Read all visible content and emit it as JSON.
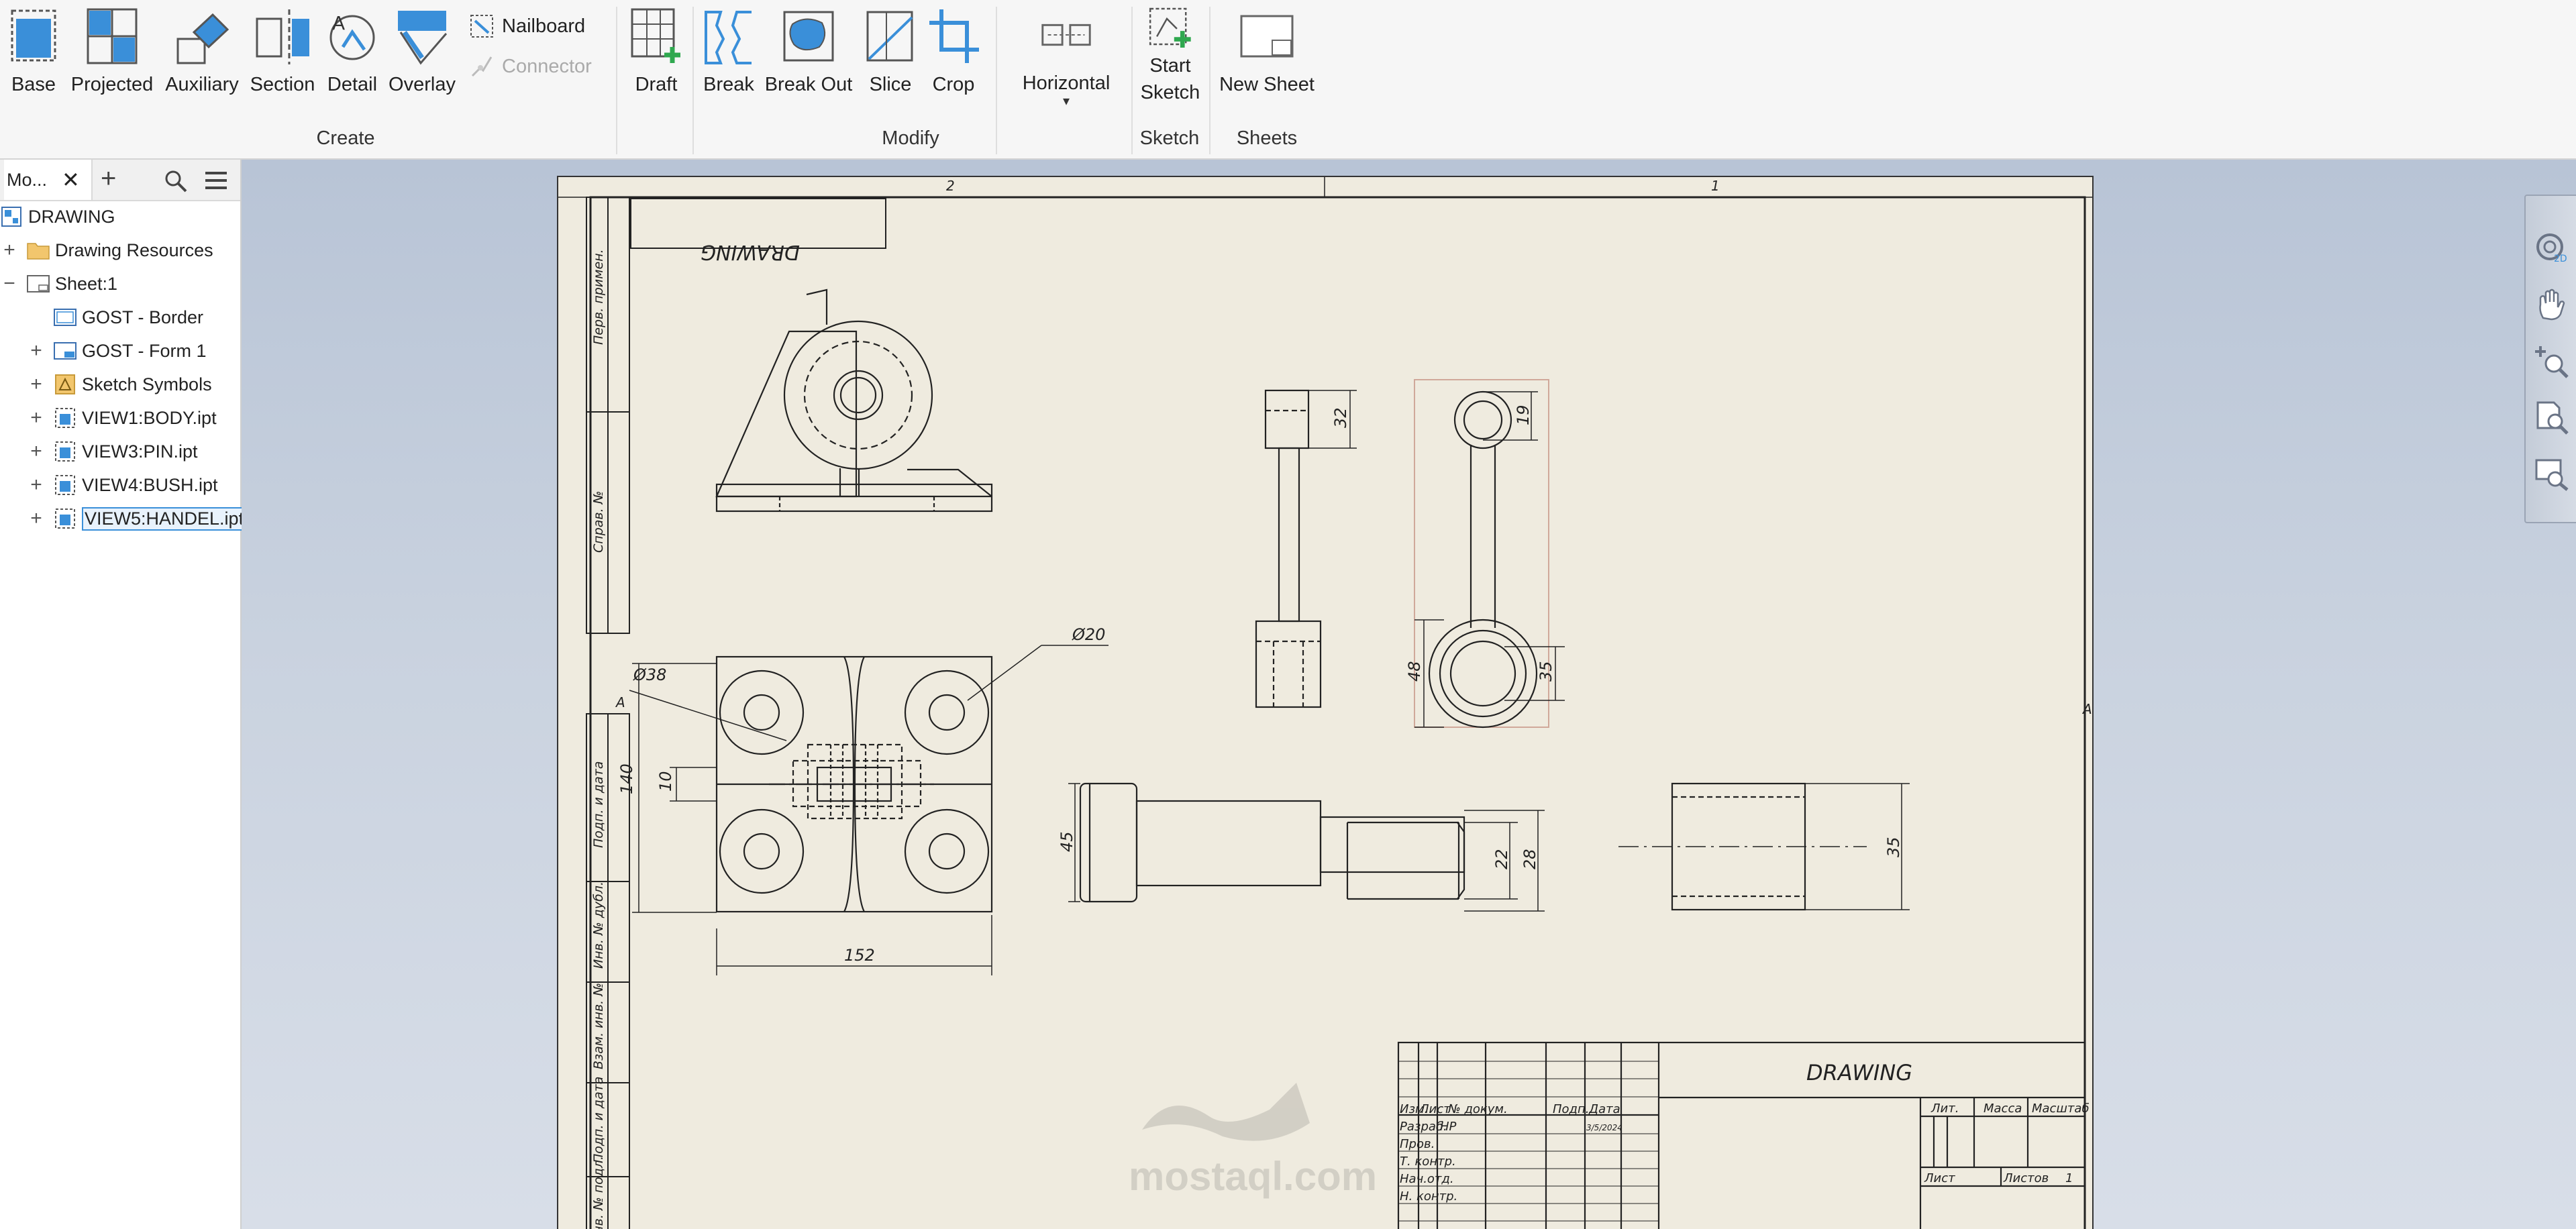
{
  "ribbon": {
    "create": {
      "group_label": "Create",
      "base": "Base",
      "projected": "Projected",
      "auxiliary": "Auxiliary",
      "section": "Section",
      "detail": "Detail",
      "overlay": "Overlay",
      "nailboard": "Nailboard",
      "connector": "Connector",
      "draft": "Draft"
    },
    "modify": {
      "group_label": "Modify",
      "break": "Break",
      "break_out": "Break Out",
      "slice": "Slice",
      "crop": "Crop",
      "horizontal": "Horizontal"
    },
    "sketch": {
      "group_label": "Sketch",
      "start_sketch_line1": "Start",
      "start_sketch_line2": "Sketch"
    },
    "sheets": {
      "group_label": "Sheets",
      "new_sheet": "New Sheet"
    }
  },
  "browser": {
    "tab_label": "Mo...",
    "tree": {
      "root": "DRAWING",
      "drawing_resources": "Drawing Resources",
      "sheet": "Sheet:1",
      "border": "GOST - Border",
      "form": "GOST - Form 1",
      "sketch_symbols": "Sketch Symbols",
      "view1": "VIEW1:BODY.ipt",
      "view3": "VIEW3:PIN.ipt",
      "view4": "VIEW4:BUSH.ipt",
      "view5": "VIEW5:HANDEL.ipt"
    }
  },
  "sheet": {
    "zone_top_2": "2",
    "zone_top_1": "1",
    "zone_side_a": "A",
    "zone_side_a_left": "A",
    "stamp_mirrored": "DRAWING",
    "side_labels": {
      "perv_primen": "Перв. примен.",
      "sprav_no": "Справ. №",
      "podp_data_1": "Подп. и дата",
      "inv_dubl": "Инв. № дубл.",
      "vzam_inv": "Взам. инв. №",
      "podp_data_2": "Подп. и дата",
      "inv_podl": "Инв. № подл."
    },
    "dimensions": {
      "d38": "Ø38",
      "d20": "Ø20",
      "d140": "140",
      "d10": "10",
      "d152": "152",
      "d32": "32",
      "d19": "19",
      "d48": "48",
      "d35_handle": "35",
      "d45": "45",
      "d22": "22",
      "d28": "28",
      "d35_bush": "35"
    },
    "title_block": {
      "title": "DRAWING",
      "izm": "Изм.",
      "list": "Лист",
      "n_dokum": "№ докум.",
      "podp": "Подп.",
      "data": "Дата",
      "razrab": "Разраб.",
      "razrab_name": "HP",
      "razrab_date": "3/5/2024",
      "prov": "Пров.",
      "t_kontr": "Т. контр.",
      "nach_otd": "Нач.отд.",
      "n_kontr": "Н. контр.",
      "lit": "Лит.",
      "massa": "Масса",
      "masshtab": "Масштаб",
      "list2": "Лист",
      "listov": "Листов",
      "listov_val": "1"
    },
    "watermark_text": "mostaql.com"
  },
  "colors": {
    "accent_blue": "#3a8fd9",
    "sheet_paper": "#efebdf",
    "canvas_bg": "#c9d2df",
    "plus_green": "#2fa84f"
  }
}
